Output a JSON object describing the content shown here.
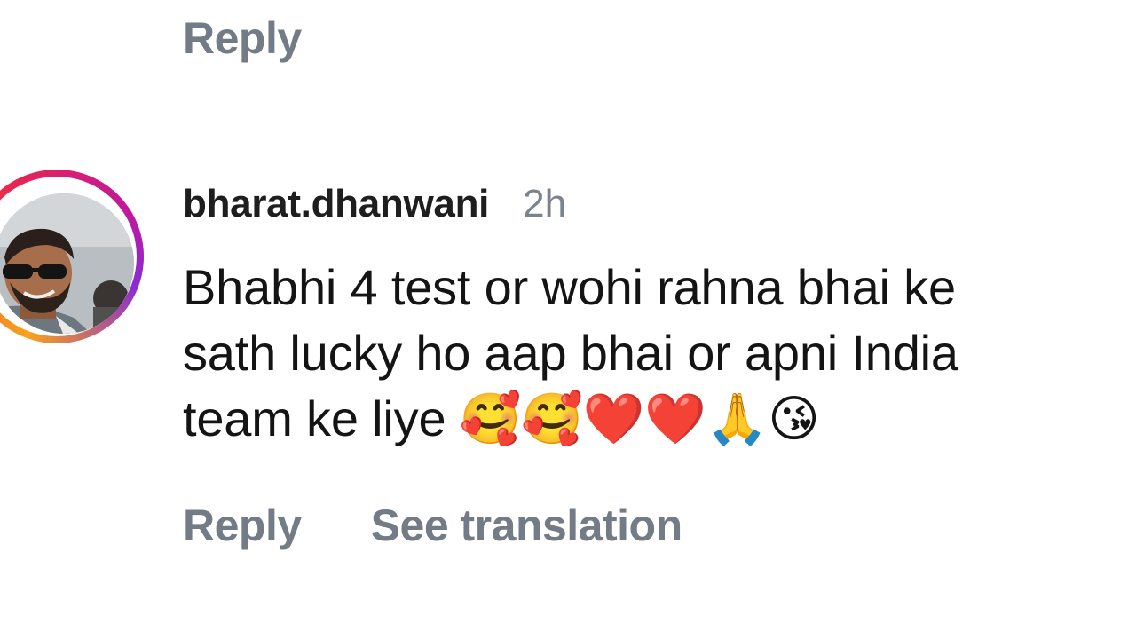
{
  "previous_comment": {
    "reply_label": "Reply"
  },
  "comment": {
    "username": "bharat.dhanwani",
    "time": "2h",
    "text": "Bhabhi 4 test or wohi rahna bhai ke\nsath lucky ho aap bhai or apni India\nteam ke liye 🥰🥰❤️❤️🙏😘",
    "avatar_icon": "user-profile-photo",
    "story_ring_colors": [
      "#f9a21b",
      "#e8264f",
      "#c2189b",
      "#8a2bd1"
    ]
  },
  "actions": {
    "reply_label": "Reply",
    "translate_label": "See translation"
  },
  "colors": {
    "secondary_text": "#737b86",
    "primary_text": "#141414",
    "background": "#ffffff"
  }
}
